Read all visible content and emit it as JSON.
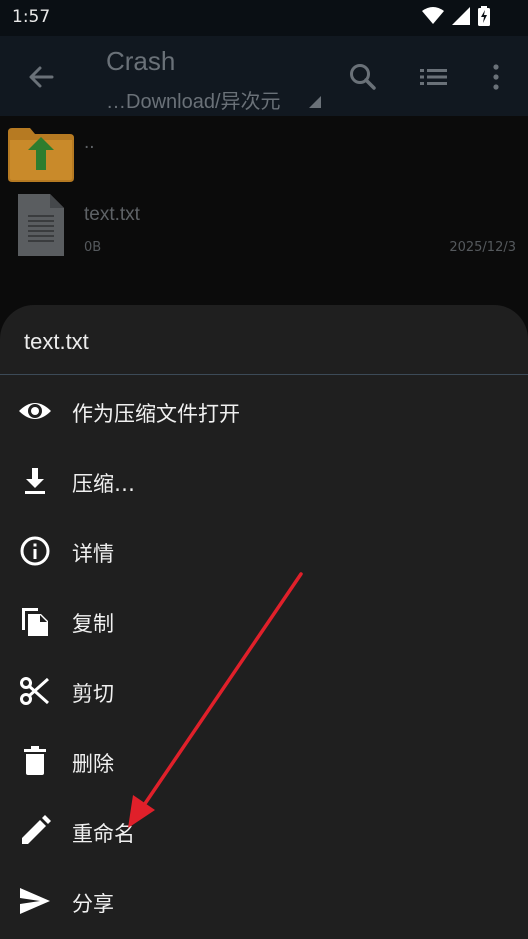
{
  "status_bar": {
    "time": "1:57",
    "icons": [
      "wifi-icon",
      "signal-icon",
      "battery-charging-icon"
    ]
  },
  "app_bar": {
    "title": "Crash",
    "path": "…Download/异次元",
    "actions": [
      "back-arrow-icon",
      "search-icon",
      "list-view-icon",
      "more-vert-icon"
    ]
  },
  "files": [
    {
      "name": "..",
      "icon": "folder-up-icon"
    },
    {
      "name": "text.txt",
      "size": "0B",
      "date": "2025/12/3",
      "icon": "text-file-icon"
    }
  ],
  "sheet": {
    "title": "text.txt",
    "items": [
      {
        "label": "作为压缩文件打开",
        "icon": "eye-icon"
      },
      {
        "label": "压缩…",
        "icon": "download-icon"
      },
      {
        "label": "详情",
        "icon": "info-icon"
      },
      {
        "label": "复制",
        "icon": "copy-icon"
      },
      {
        "label": "剪切",
        "icon": "scissors-icon"
      },
      {
        "label": "删除",
        "icon": "trash-icon"
      },
      {
        "label": "重命名",
        "icon": "pencil-icon"
      },
      {
        "label": "分享",
        "icon": "send-icon"
      }
    ]
  },
  "colors": {
    "sheet_bg": "#1f1f1f",
    "appbar_bg": "#111820",
    "annotation_arrow": "#e0202a",
    "folder": "#c98a2a",
    "folder_arrow": "#2e7d2e"
  }
}
